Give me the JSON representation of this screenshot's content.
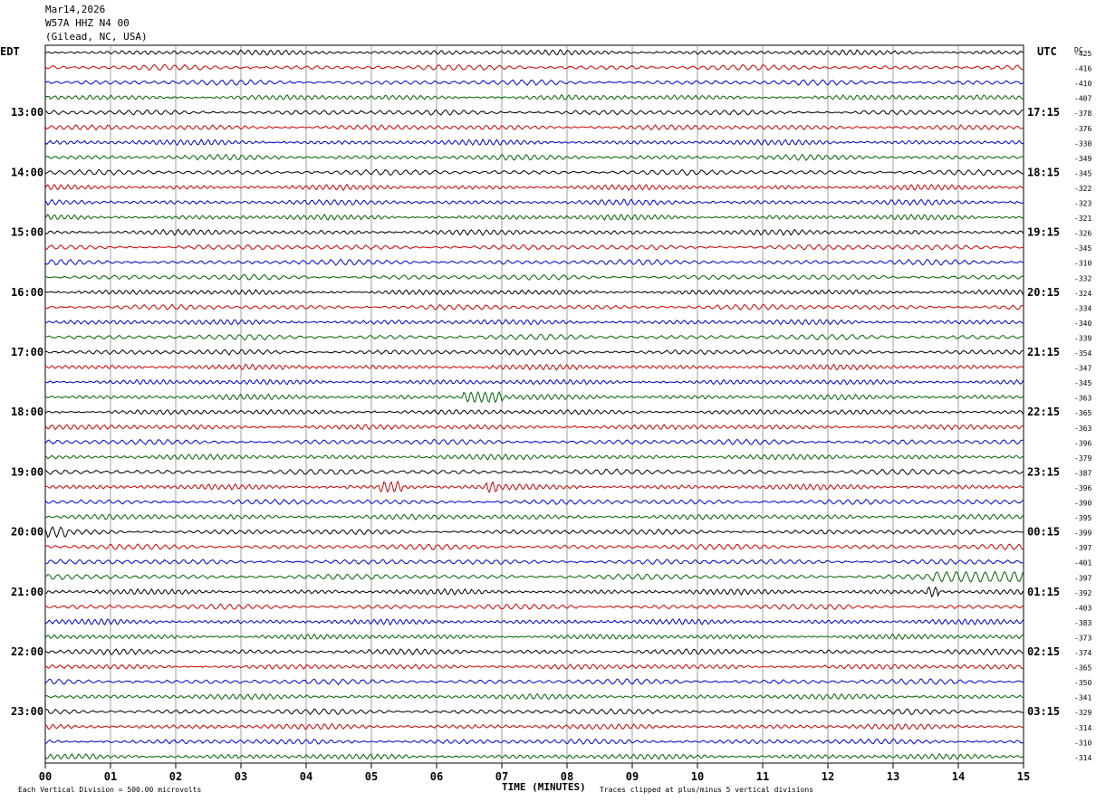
{
  "header": {
    "date": "Mar14,2026",
    "station": "W57A HHZ N4 00",
    "location": "(Gilead, NC, USA)"
  },
  "left_zone_label": "EDT",
  "right_zone_label": "UTC",
  "dc_label": "DC",
  "footer": {
    "division_note": "Each Vertical Division =  500.00 microvolts",
    "xlabel": "TIME (MINUTES)",
    "clip_note": "Traces clipped at plus/minus 5 vertical divisions"
  },
  "colors": {
    "cycle": [
      "#000000",
      "#d00000",
      "#0000cc",
      "#006400"
    ],
    "grid": "#888888"
  },
  "chart_data": {
    "type": "line",
    "title": "W57A HHZ N4 00",
    "xlabel": "TIME (MINUTES)",
    "xlim": [
      0,
      15
    ],
    "x_ticks": [
      "00",
      "01",
      "02",
      "03",
      "04",
      "05",
      "06",
      "07",
      "08",
      "09",
      "10",
      "11",
      "12",
      "13",
      "14",
      "15"
    ],
    "left_hour_labels": [
      "13:00",
      "14:00",
      "15:00",
      "16:00",
      "17:00",
      "18:00",
      "19:00",
      "20:00",
      "21:00",
      "22:00",
      "23:00"
    ],
    "right_hour_labels": [
      "17:15",
      "18:15",
      "19:15",
      "20:15",
      "21:15",
      "22:15",
      "23:15",
      "00:15",
      "01:15",
      "02:15",
      "03:15"
    ],
    "first_labeled_row": 4,
    "rows_per_hour": 4,
    "dc_offsets": [
      -425,
      -416,
      -410,
      -407,
      -378,
      -376,
      -330,
      -349,
      -345,
      -322,
      -323,
      -321,
      -326,
      -345,
      -310,
      -332,
      -324,
      -334,
      -340,
      -339,
      -354,
      -347,
      -345,
      -363,
      -365,
      -363,
      -396,
      -379,
      -387,
      -396,
      -390,
      -395,
      -399,
      -397,
      -401,
      -397,
      -392,
      -403,
      -383,
      -373,
      -374,
      -365,
      -350,
      -341,
      -329,
      -314,
      -310,
      -314
    ],
    "events": [
      {
        "row": 23,
        "minute_start": 6.4,
        "minute_end": 7.0
      },
      {
        "row": 29,
        "minute_start": 5.1,
        "minute_end": 5.5
      },
      {
        "row": 29,
        "minute_start": 6.75,
        "minute_end": 6.95
      },
      {
        "row": 32,
        "minute_start": 0.0,
        "minute_end": 0.35
      },
      {
        "row": 35,
        "minute_start": 13.6,
        "minute_end": 15.0
      },
      {
        "row": 36,
        "minute_start": 13.5,
        "minute_end": 13.7
      }
    ]
  }
}
